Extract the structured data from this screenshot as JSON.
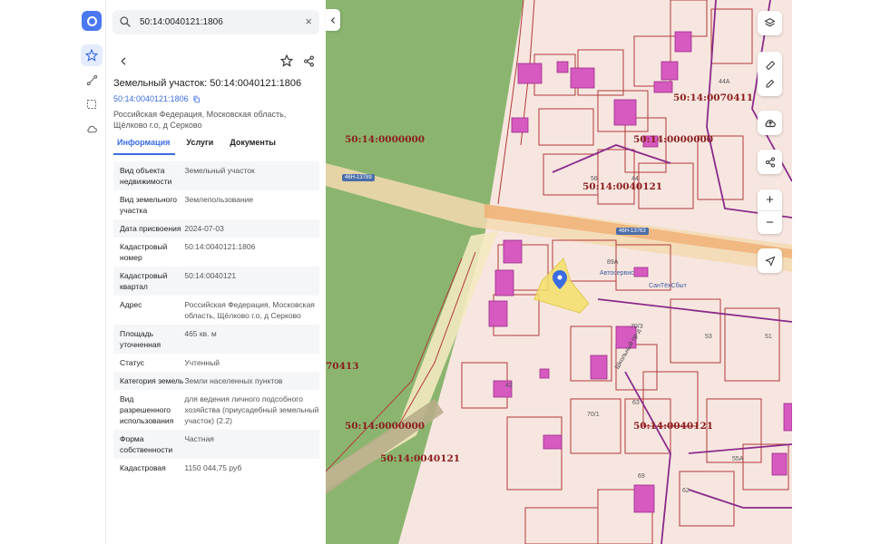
{
  "search": {
    "value": "50:14:0040121:1806",
    "placeholder": ""
  },
  "parcel": {
    "title": "Земельный участок: 50:14:0040121:1806",
    "cadastral_number": "50:14:0040121:1806",
    "address": "Российская Федерация, Московская область, Щёлково г.о, д Серково"
  },
  "tabs": [
    {
      "label": "Информация"
    },
    {
      "label": "Услуги"
    },
    {
      "label": "Документы"
    }
  ],
  "info": [
    {
      "key": "Вид объекта недвижимости",
      "value": "Земельный участок"
    },
    {
      "key": "Вид земельного участка",
      "value": "Землепользование"
    },
    {
      "key": "Дата присвоения",
      "value": "2024-07-03"
    },
    {
      "key": "Кадастровый номер",
      "value": "50:14:0040121:1806"
    },
    {
      "key": "Кадастровый квартал",
      "value": "50:14:0040121"
    },
    {
      "key": "Адрес",
      "value": "Российская Федерация, Московская область, Щёлково г.о, д Серково"
    },
    {
      "key": "Площадь уточненная",
      "value": "465 кв. м"
    },
    {
      "key": "Статус",
      "value": "Учтенный"
    },
    {
      "key": "Категория земель",
      "value": "Земли населенных пунктов"
    },
    {
      "key": "Вид разрешенного использования",
      "value": "для ведения личного подсобного хозяйства (приусадебный земельный участок) (2.2)"
    },
    {
      "key": "Форма собственности",
      "value": "Частная"
    },
    {
      "key": "Кадастровая",
      "value": "1150 044,75 руб"
    }
  ],
  "map": {
    "labels": [
      {
        "text": "50:14:0000000"
      },
      {
        "text": "50:14:0070411"
      },
      {
        "text": "50:14:0000000"
      },
      {
        "text": "50:14:0040121"
      },
      {
        "text": "70413"
      },
      {
        "text": "50:14:0000000"
      },
      {
        "text": "50:14:0040121"
      },
      {
        "text": "50:14:0040121"
      }
    ],
    "road_tags": [
      "46Н-13789",
      "46Н-13763"
    ],
    "poi": [
      "Автосервис",
      "СанТёхСбыт"
    ],
    "house_numbers": [
      "44А",
      "56",
      "44",
      "89А",
      "70/3",
      "53",
      "51",
      "63",
      "70/1",
      "55А",
      "62",
      "69",
      "42"
    ],
    "street": "Школьный пр-д"
  },
  "colors": {
    "accent": "#3b6ce0",
    "forest": "#8bb56f",
    "parcel_fill": "#f7e2dc",
    "building": "#d65ac0",
    "boundary": "#b23a3a",
    "selected": "#f4e16b"
  },
  "icons": {
    "rail": [
      "favorites-star-icon",
      "route-icon",
      "select-area-icon",
      "cloud-icon"
    ],
    "controls": [
      "layers-icon",
      "ruler-icon",
      "edit-icon",
      "upload-icon",
      "share-icon",
      "zoom-in-icon",
      "zoom-out-icon",
      "locate-icon"
    ]
  }
}
